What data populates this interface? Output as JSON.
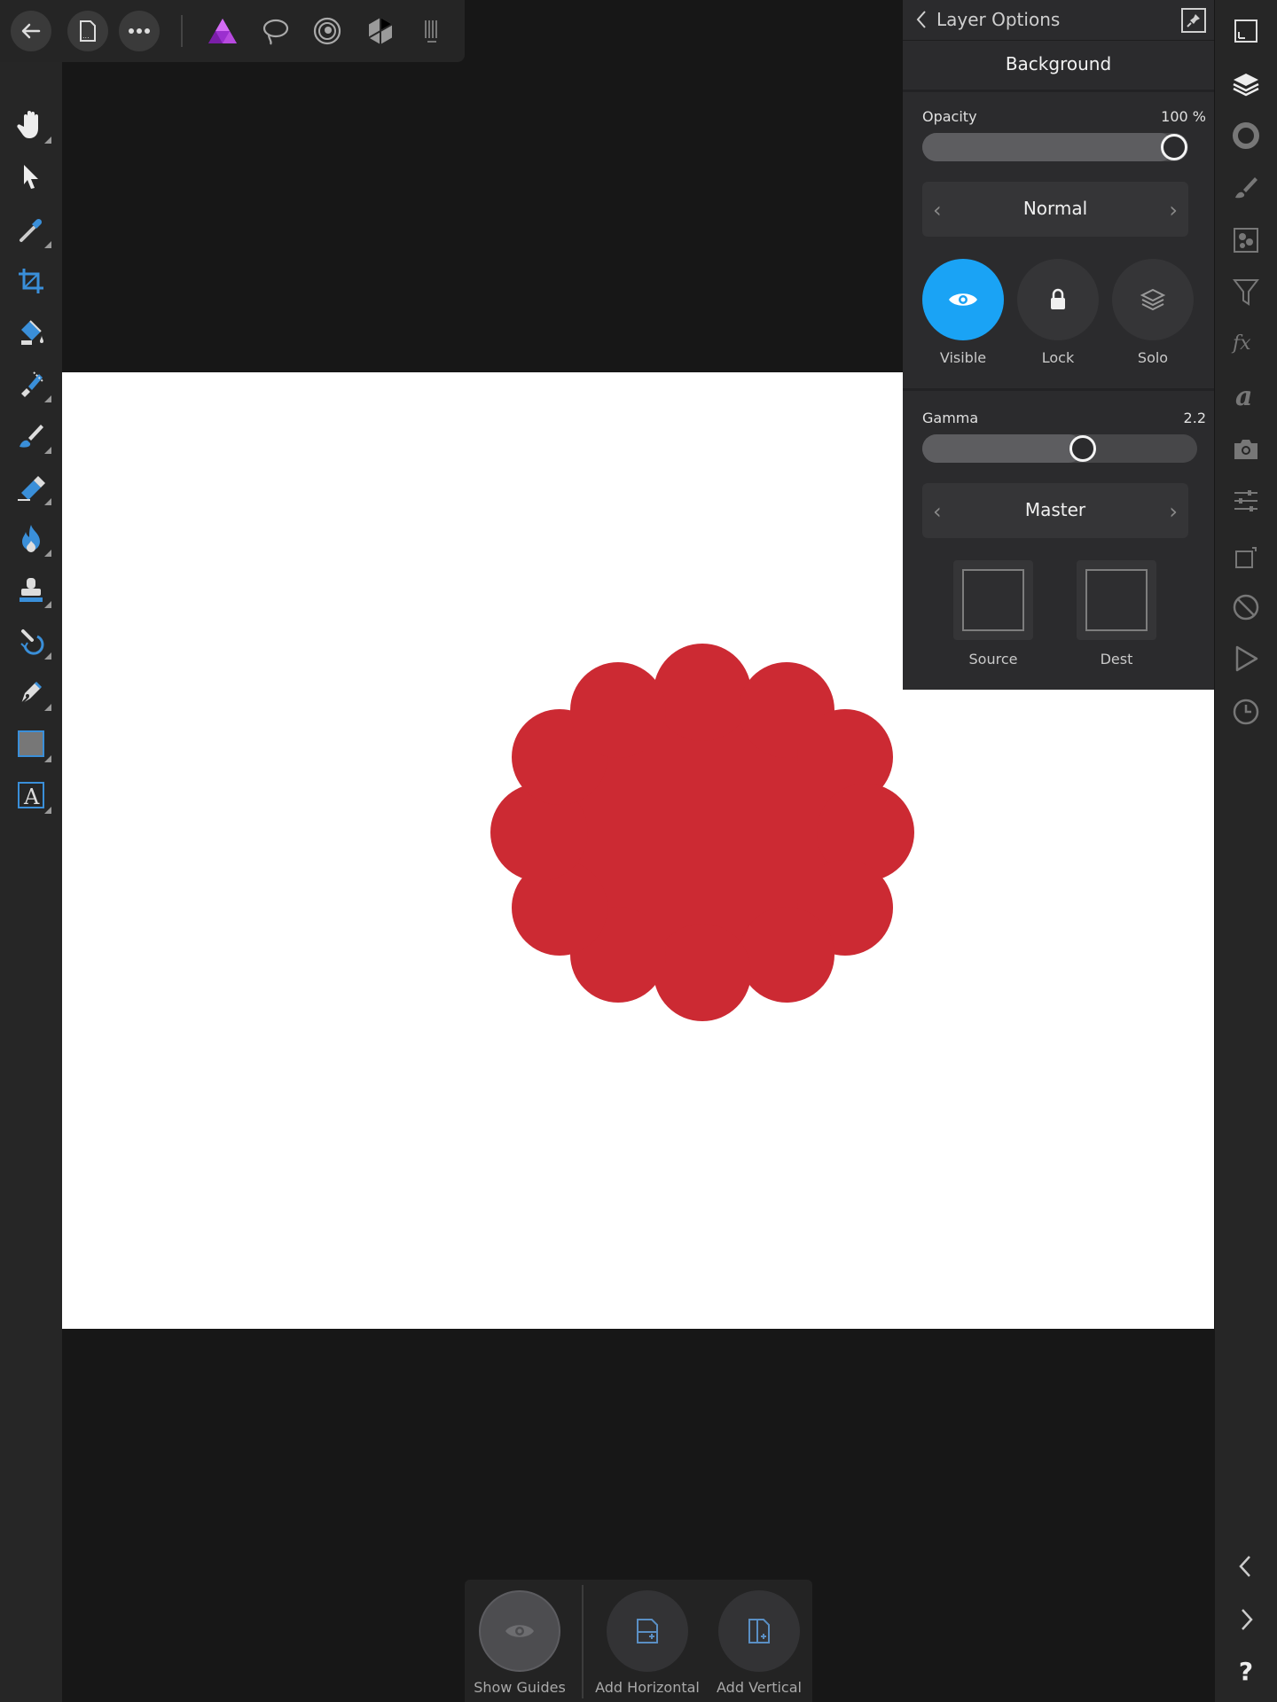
{
  "top_toolbar": {
    "buttons": [
      "back-icon",
      "document-icon",
      "more-icon"
    ],
    "personas": [
      "photo-persona-icon",
      "selection-persona-icon",
      "liquify-persona-icon",
      "develop-persona-icon",
      "tone-mapping-persona-icon"
    ]
  },
  "left_tools": [
    "view-tool",
    "move-tool",
    "color-picker-tool",
    "crop-tool",
    "flood-fill-tool",
    "selection-brush-tool",
    "paint-brush-tool",
    "erase-brush-tool",
    "burn-brush-tool",
    "clone-brush-tool",
    "inpainting-brush-tool",
    "pen-tool",
    "rectangle-tool",
    "text-tool"
  ],
  "right_studios": [
    "canvas-studio",
    "layers-studio",
    "color-studio",
    "brushes-studio",
    "channels-studio",
    "adjustments-studio",
    "effects-studio",
    "text-styles-studio",
    "stock-studio",
    "transform-studio",
    "snapshots-studio",
    "macros-studio",
    "history-studio"
  ],
  "layer_panel": {
    "title": "Layer Options",
    "layer_name": "Background",
    "opacity_label": "Opacity",
    "opacity_value": "100 %",
    "opacity_fraction": 1.0,
    "blend_mode": "Normal",
    "visible_label": "Visible",
    "lock_label": "Lock",
    "solo_label": "Solo",
    "gamma_label": "Gamma",
    "gamma_value": "2.2",
    "gamma_fraction": 0.595,
    "channel": "Master",
    "source_label": "Source",
    "dest_label": "Dest"
  },
  "guides_bar": {
    "show_guides": "Show Guides",
    "add_horizontal": "Add Horizontal",
    "add_vertical": "Add Vertical"
  },
  "bottom_right": {
    "help": "?"
  },
  "colors": {
    "accent": "#1aa3f5",
    "shape_fill": "#cc2a33",
    "document_bg": "#ffffff",
    "workspace_bg": "#171717"
  }
}
